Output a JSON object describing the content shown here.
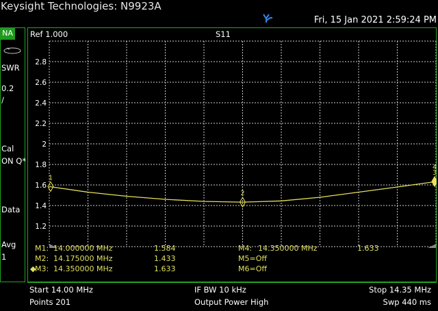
{
  "header": {
    "title": "Keysight Technologies: N9923A",
    "datetime": "Fri, 15 Jan 2021 2:59:24 PM",
    "usb_icon": "usb-icon"
  },
  "left_panel": {
    "mode": "NA",
    "format": "SWR",
    "scale": "0.2",
    "scale_unit": "/",
    "cal": "Cal",
    "cal_state": "ON Q*",
    "data": "Data",
    "avg": "Avg",
    "avg_count": "1"
  },
  "plot": {
    "ref_label": "Ref 1.000",
    "measurement": "S11",
    "y_ticks": [
      "2.8",
      "2.6",
      "2.4",
      "2.2",
      "2",
      "1.8",
      "1.6",
      "1.4",
      "1.2"
    ],
    "trace_color": "#e8e05a",
    "grid_color": "#cfcfcf",
    "frame_color": "#1fa51f"
  },
  "chart_data": {
    "type": "line",
    "xlabel": "",
    "ylabel": "",
    "xlim": [
      14.0,
      14.35
    ],
    "ylim": [
      1.0,
      3.0
    ],
    "x_unit": "MHz",
    "series": [
      {
        "x": [
          14.0,
          14.035,
          14.07,
          14.105,
          14.14,
          14.175,
          14.21,
          14.245,
          14.28,
          14.315,
          14.35
        ],
        "values": [
          1.584,
          1.53,
          1.49,
          1.46,
          1.44,
          1.433,
          1.445,
          1.48,
          1.53,
          1.58,
          1.633
        ]
      }
    ],
    "markers": [
      {
        "id": "1",
        "x": 14.0,
        "y": 1.584
      },
      {
        "id": "2",
        "x": 14.175,
        "y": 1.433
      },
      {
        "id": "3",
        "x": 14.35,
        "y": 1.633
      },
      {
        "id": "4",
        "x": 14.35,
        "y": 1.633
      }
    ]
  },
  "marker_table": {
    "m1_label": "M1:",
    "m1_freq": "14.000000 MHz",
    "m1_val": "1.584",
    "m2_label": "M2:",
    "m2_freq": "14.175000 MHz",
    "m2_val": "1.433",
    "m3_label": "M3:",
    "m3_freq": "14.350000 MHz",
    "m3_val": "1.633",
    "m4_label": "M4:",
    "m4_freq": "14.350000 MHz",
    "m4_val": "1.633",
    "m5": "M5=Off",
    "m6": "M6=Off"
  },
  "footer": {
    "start": "Start 14.00 MHz",
    "ifbw": "IF BW 10 kHz",
    "stop": "Stop 14.35 MHz",
    "points": "Points 201",
    "power": "Output Power High",
    "sweep": "Swp 440 ms"
  }
}
